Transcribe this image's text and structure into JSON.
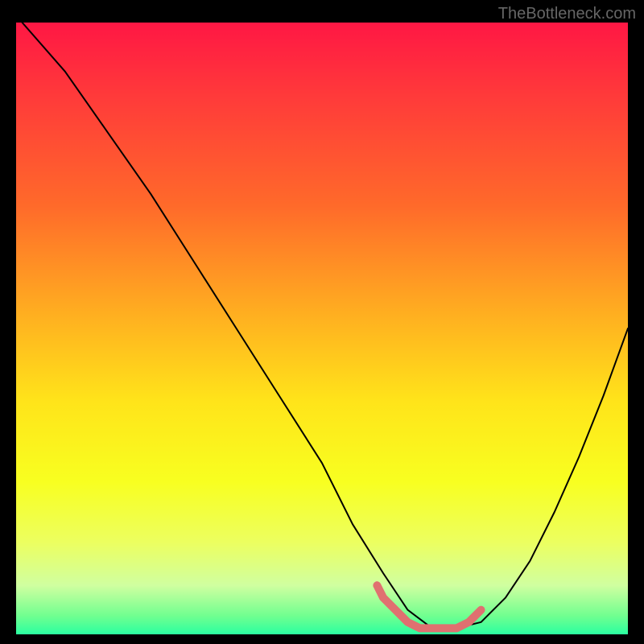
{
  "watermark": "TheBottleneck.com",
  "chart_data": {
    "type": "line",
    "title": "",
    "xlabel": "",
    "ylabel": "",
    "xlim": [
      0,
      100
    ],
    "ylim": [
      0,
      100
    ],
    "background_gradient": {
      "stops": [
        {
          "offset": 0,
          "color": "#ff1744"
        },
        {
          "offset": 12,
          "color": "#ff3a3a"
        },
        {
          "offset": 30,
          "color": "#ff6a2a"
        },
        {
          "offset": 48,
          "color": "#ffb020"
        },
        {
          "offset": 62,
          "color": "#ffe41a"
        },
        {
          "offset": 75,
          "color": "#f8ff20"
        },
        {
          "offset": 85,
          "color": "#ecff60"
        },
        {
          "offset": 92,
          "color": "#d0ffa0"
        },
        {
          "offset": 97,
          "color": "#70ff90"
        },
        {
          "offset": 100,
          "color": "#2affa0"
        }
      ]
    },
    "series": [
      {
        "name": "bottleneck-curve",
        "color": "#000000",
        "width": 2,
        "x": [
          1,
          8,
          15,
          22,
          29,
          36,
          43,
          50,
          55,
          60,
          64,
          68,
          72,
          76,
          80,
          84,
          88,
          92,
          96,
          100
        ],
        "y": [
          100,
          92,
          82,
          72,
          61,
          50,
          39,
          28,
          18,
          10,
          4,
          1,
          1,
          2,
          6,
          12,
          20,
          29,
          39,
          50
        ]
      },
      {
        "name": "optimal-range-highlight",
        "color": "#e07070",
        "width": 10,
        "x": [
          59,
          60,
          62,
          64,
          66,
          68,
          70,
          72,
          74,
          76
        ],
        "y": [
          8,
          6,
          4,
          2,
          1,
          1,
          1,
          1,
          2,
          4
        ]
      }
    ]
  }
}
